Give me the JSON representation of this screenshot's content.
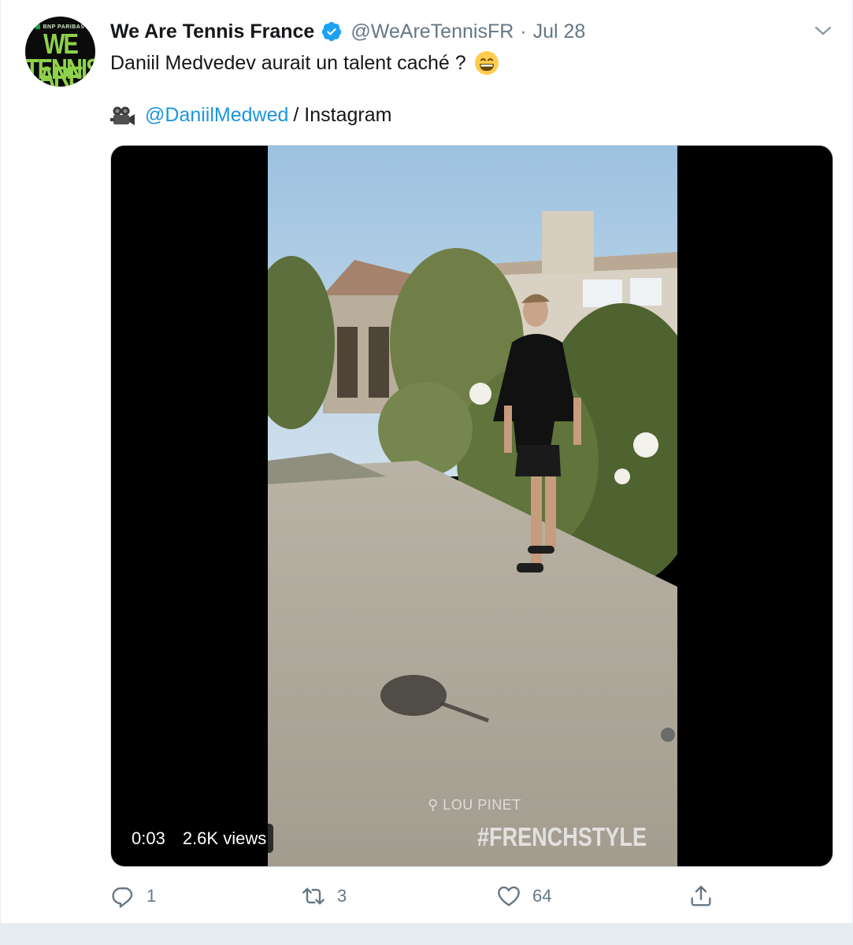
{
  "tweet": {
    "display_name": "We Are Tennis France",
    "handle": "@WeAreTennisFR",
    "separator": "·",
    "date": "Jul 28",
    "text_line1": "Daniil Medvedev aurait un talent caché ?",
    "emoji": "grinning-face-with-smiling-eyes",
    "mention": "@DaniilMedwed",
    "source_suffix": "/ Instagram",
    "camera_icon": "movie-camera-icon",
    "verified": true
  },
  "avatar": {
    "brand": "BNP PARIBAS",
    "line1": "WE ARE",
    "line2": "TENNIS"
  },
  "media": {
    "timestamp": "0:03",
    "views": "2.6K views",
    "location_sticker": "LOU PINET",
    "hashtag_sticker": "#FRENCHSTYLE"
  },
  "actions": {
    "reply_count": "1",
    "retweet_count": "3",
    "like_count": "64"
  },
  "colors": {
    "link": "#1b95e0",
    "secondary_text": "#657786",
    "primary_text": "#14171a",
    "verified": "#1da1f2"
  }
}
